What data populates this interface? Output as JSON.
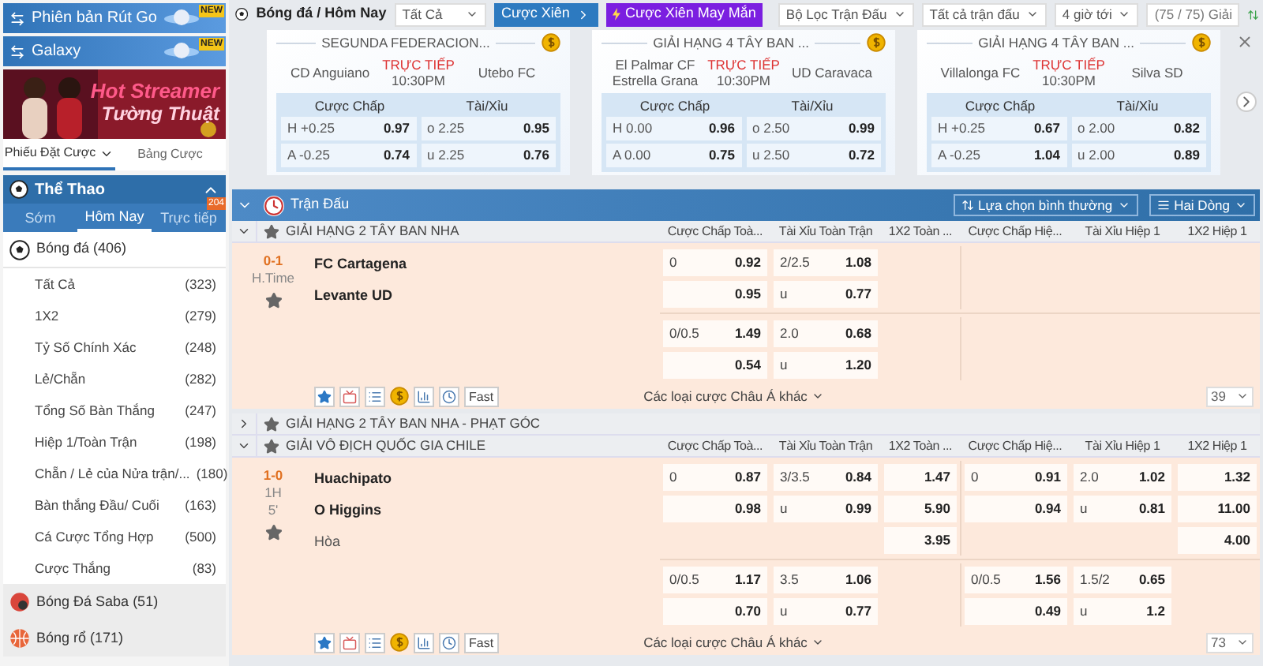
{
  "sidebar": {
    "banners": [
      {
        "label": "Phiên bản Rút Go",
        "badge": "NEW"
      },
      {
        "label": "Galaxy",
        "badge": "NEW"
      }
    ],
    "promo": {
      "kind": "picture",
      "lines": [
        "Hot Streamer",
        "Tường Thuật"
      ]
    },
    "bet_tabs": [
      {
        "label": "Phiếu Đặt Cược",
        "selected": true
      },
      {
        "label": "Bảng Cược",
        "selected": false
      }
    ],
    "sports_header": {
      "title": "Thể Thao",
      "expanded": true
    },
    "period_tabs": [
      {
        "label": "Sớm",
        "selected": false
      },
      {
        "label": "Hôm Nay",
        "selected": true
      },
      {
        "label": "Trực tiếp",
        "selected": false,
        "badge": "204"
      }
    ],
    "sports": [
      {
        "kind": "soccer",
        "name": "Bóng đá",
        "count": "(406)",
        "expanded": true,
        "children": [
          {
            "label": "Tất Cả",
            "count": "(323)"
          },
          {
            "label": "1X2",
            "count": "(279)"
          },
          {
            "label": "Tỷ Số Chính Xác",
            "count": "(248)"
          },
          {
            "label": "Lẻ/Chẵn",
            "count": "(282)"
          },
          {
            "label": "Tổng Số Bàn Thắng",
            "count": "(247)"
          },
          {
            "label": "Hiệp 1/Toàn Trận",
            "count": "(198)"
          },
          {
            "label": "Chẵn / Lẻ của Nửa trận/...",
            "count": "(180)"
          },
          {
            "label": "Bàn thắng Đầu/ Cuối",
            "count": "(163)"
          },
          {
            "label": "Cá Cược Tổng Hợp",
            "count": "(500)"
          },
          {
            "label": "Cược Thắng",
            "count": "(83)"
          }
        ]
      },
      {
        "kind": "saba",
        "name": "Bóng Đá Saba",
        "count": "(51)",
        "expanded": false
      },
      {
        "kind": "basketball",
        "name": "Bóng rổ",
        "count": "(171)",
        "expanded": false
      }
    ]
  },
  "toolbar": {
    "breadcrumb": "Bóng đá / Hôm Nay",
    "market_select": "Tất Cả",
    "parlay_button": "Cược Xiên",
    "lucky_button": "Cược Xiên May Mắn",
    "filters": [
      "Bộ Lọc Trận Đấu",
      "Tất cả trận đấu",
      "4 giờ tới"
    ],
    "league_count": "(75 / 75) Giải"
  },
  "featured": [
    {
      "league": "SEGUNDA FEDERACION...",
      "home": "CD Anguiano",
      "away": "Utebo FC",
      "status": "TRỰC TIẾP",
      "time": "10:30PM",
      "markets": [
        "Cược Chấp",
        "Tài/Xỉu"
      ],
      "handicap": [
        {
          "line": "H +0.25",
          "odds": "0.97"
        },
        {
          "line": "A -0.25",
          "odds": "0.74"
        }
      ],
      "total": [
        {
          "line": "o 2.25",
          "odds": "0.95"
        },
        {
          "line": "u 2.25",
          "odds": "0.76"
        }
      ]
    },
    {
      "league": "GIẢI HẠNG 4 TÂY BAN ...",
      "home": "El Palmar CF Estrella Grana",
      "away": "UD Caravaca",
      "status": "TRỰC TIẾP",
      "time": "10:30PM",
      "markets": [
        "Cược Chấp",
        "Tài/Xỉu"
      ],
      "handicap": [
        {
          "line": "H 0.00",
          "odds": "0.96"
        },
        {
          "line": "A 0.00",
          "odds": "0.75"
        }
      ],
      "total": [
        {
          "line": "o 2.50",
          "odds": "0.99"
        },
        {
          "line": "u 2.50",
          "odds": "0.72"
        }
      ]
    },
    {
      "league": "GIẢI HẠNG 4 TÂY BAN ...",
      "home": "Villalonga FC",
      "away": "Silva SD",
      "status": "TRỰC TIẾP",
      "time": "10:30PM",
      "markets": [
        "Cược Chấp",
        "Tài/Xỉu"
      ],
      "handicap": [
        {
          "line": "H +0.25",
          "odds": "0.67"
        },
        {
          "line": "A -0.25",
          "odds": "1.04"
        }
      ],
      "total": [
        {
          "line": "o 2.00",
          "odds": "0.82"
        },
        {
          "line": "u 2.00",
          "odds": "0.89"
        }
      ]
    }
  ],
  "section": {
    "title": "Trận Đấu",
    "options": [
      "Lựa chọn bình thường",
      "Hai Dòng"
    ]
  },
  "leagues": [
    {
      "name": "GIẢI HẠNG 2 TÂY BAN NHA",
      "expanded": true,
      "columns": [
        "Cược Chấp Toà...",
        "Tài Xỉu Toàn Trận",
        "1X2 Toàn ...",
        "Cược Chấp Hiệ...",
        "Tài Xỉu Hiệp 1",
        "1X2 Hiệp 1"
      ],
      "matches": [
        {
          "score": "0-1",
          "period": [
            "H.Time"
          ],
          "home": "FC Cartagena",
          "away": "Levante UD",
          "groups": [
            [
              {
                "handicap": {
                  "line": "0",
                  "odds": "0.92"
                },
                "total": {
                  "line": "2/2.5",
                  "odds": "1.08"
                }
              },
              {
                "handicap": {
                  "odds": "0.95"
                },
                "total": {
                  "line": "u",
                  "odds": "0.77"
                }
              }
            ],
            [
              {
                "handicap": {
                  "line": "0/0.5",
                  "odds": "1.49"
                },
                "total": {
                  "line": "2.0",
                  "odds": "0.68"
                }
              },
              {
                "handicap": {
                  "odds": "0.54"
                },
                "total": {
                  "line": "u",
                  "odds": "1.20"
                }
              }
            ]
          ],
          "more": "Các loại cược Châu Á khác",
          "fast": "Fast",
          "count": "39"
        }
      ]
    },
    {
      "name": "GIẢI HẠNG 2 TÂY BAN NHA - PHẠT GÓC",
      "expanded": false
    },
    {
      "name": "GIẢI VÔ ĐỊCH QUỐC GIA CHILE",
      "expanded": true,
      "columns": [
        "Cược Chấp Toà...",
        "Tài Xỉu Toàn Trận",
        "1X2 Toàn ...",
        "Cược Chấp Hiệ...",
        "Tài Xỉu Hiệp 1",
        "1X2 Hiệp 1"
      ],
      "matches": [
        {
          "score": "1-0",
          "period": [
            "1H",
            "5'"
          ],
          "home": "Huachipato",
          "away": "O Higgins",
          "draw": "Hòa",
          "groups": [
            [
              {
                "handicap": {
                  "line": "0",
                  "odds": "0.87"
                },
                "total": {
                  "line": "3/3.5",
                  "odds": "0.84"
                },
                "x12": {
                  "odds": "1.47"
                },
                "handicap_h1": {
                  "line": "0",
                  "odds": "0.91"
                },
                "total_h1": {
                  "line": "2.0",
                  "odds": "1.02"
                },
                "x12_h1": {
                  "odds": "1.32"
                }
              },
              {
                "handicap": {
                  "odds": "0.98"
                },
                "total": {
                  "line": "u",
                  "odds": "0.99"
                },
                "x12": {
                  "odds": "5.90"
                },
                "handicap_h1": {
                  "odds": "0.94"
                },
                "total_h1": {
                  "line": "u",
                  "odds": "0.81"
                },
                "x12_h1": {
                  "odds": "11.00"
                }
              },
              {
                "x12": {
                  "odds": "3.95"
                },
                "x12_h1": {
                  "odds": "4.00"
                }
              }
            ],
            [
              {
                "handicap": {
                  "line": "0/0.5",
                  "odds": "1.17"
                },
                "total": {
                  "line": "3.5",
                  "odds": "1.06"
                },
                "handicap_h1": {
                  "line": "0/0.5",
                  "odds": "1.56"
                },
                "total_h1": {
                  "line": "1.5/2",
                  "odds": "0.65"
                }
              },
              {
                "handicap": {
                  "odds": "0.70"
                },
                "total": {
                  "line": "u",
                  "odds": "0.77"
                },
                "handicap_h1": {
                  "odds": "0.49"
                },
                "total_h1": {
                  "line": "u",
                  "odds": "1.2"
                }
              }
            ]
          ],
          "more": "Các loại cược Châu Á khác",
          "fast": "Fast",
          "count": "73"
        }
      ]
    }
  ]
}
